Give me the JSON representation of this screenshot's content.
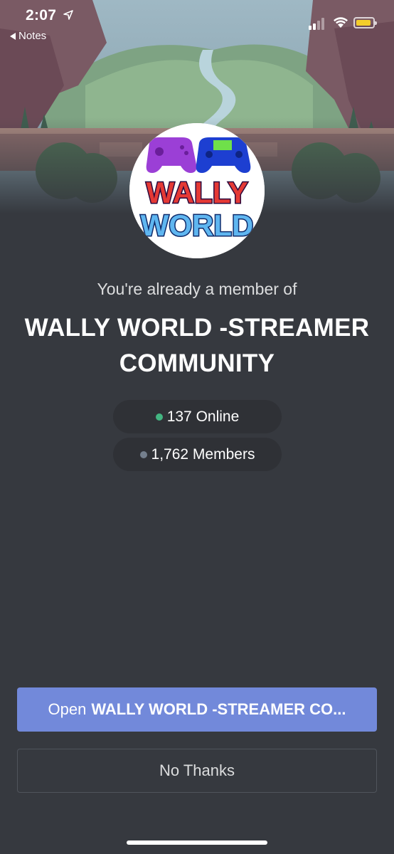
{
  "status_bar": {
    "time": "2:07",
    "back_label": "Notes"
  },
  "colors": {
    "background": "#36393f",
    "pill_background": "#2f3136",
    "primary": "#7289da",
    "online": "#43b581",
    "offline": "#747f8d"
  },
  "invite": {
    "member_label": "You're already a member of",
    "server_name": "WALLY WORLD -STREAMER COMMUNITY",
    "logo_text": [
      "WALLY",
      "WORLD"
    ],
    "online_count": "137 Online",
    "member_count": "1,762 Members"
  },
  "actions": {
    "open_prefix": "Open",
    "open_server": "WALLY WORLD -STREAMER CO...",
    "no_thanks": "No Thanks"
  },
  "icons": [
    "location-arrow-icon",
    "back-arrow-icon",
    "signal-icon",
    "wifi-icon",
    "battery-icon",
    "green-dot-icon",
    "gray-dot-icon"
  ]
}
